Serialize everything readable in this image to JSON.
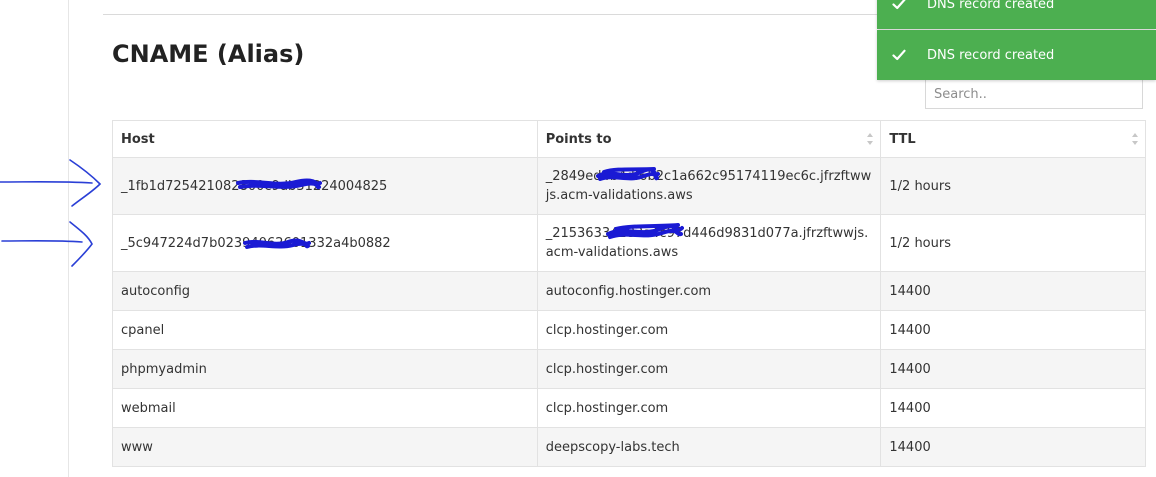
{
  "section": {
    "title": "CNAME (Alias)"
  },
  "search": {
    "placeholder": "Search.."
  },
  "table": {
    "columns": [
      {
        "label": "Host",
        "sortable": false
      },
      {
        "label": "Points to",
        "sortable": true
      },
      {
        "label": "TTL",
        "sortable": true
      }
    ],
    "rows": [
      {
        "host": "_1fb1d725421082800c9db31224004825",
        "points_to": "_2849ed4b4df6b2c1a662c95174119ec6c.jfrzftwwjs.acm-validations.aws",
        "ttl": "1/2 hours"
      },
      {
        "host": "_5c947224d7b02394062601332a4b0882",
        "points_to": "_21536334283a4c97d446d9831d077a.jfrzftwwjs.acm-validations.aws",
        "ttl": "1/2 hours"
      },
      {
        "host": "autoconfig",
        "points_to": "autoconfig.hostinger.com",
        "ttl": "14400"
      },
      {
        "host": "cpanel",
        "points_to": "clcp.hostinger.com",
        "ttl": "14400"
      },
      {
        "host": "phpmyadmin",
        "points_to": "clcp.hostinger.com",
        "ttl": "14400"
      },
      {
        "host": "webmail",
        "points_to": "clcp.hostinger.com",
        "ttl": "14400"
      },
      {
        "host": "www",
        "points_to": "deepscopy-labs.tech",
        "ttl": "14400"
      }
    ]
  },
  "toasts": [
    {
      "message": "DNS record created"
    },
    {
      "message": "DNS record created"
    }
  ],
  "colors": {
    "toast_bg": "#4caf50",
    "redaction": "#1a1ad4",
    "annotation": "#2a3fd6",
    "stripe": "#f5f5f5"
  },
  "icons": {
    "toast": "check-icon",
    "sort": "sort-arrows-icon"
  }
}
